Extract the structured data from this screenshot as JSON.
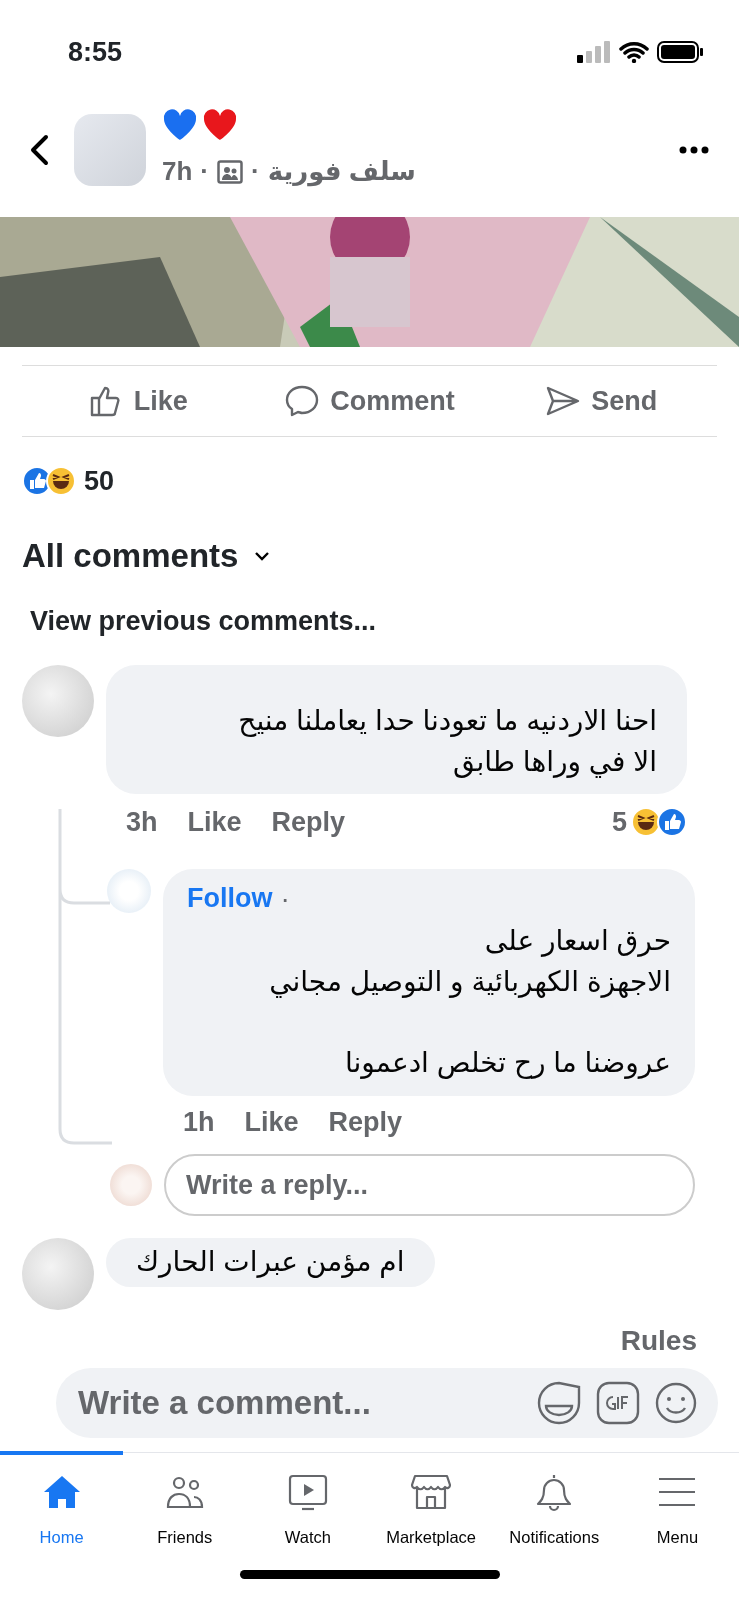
{
  "status_bar": {
    "time": "8:55"
  },
  "post_header": {
    "time": "7h",
    "separators": [
      "·",
      "·"
    ],
    "group": "سلف فورية"
  },
  "actions": [
    {
      "kind": "like",
      "label": "Like"
    },
    {
      "kind": "comment",
      "label": "Comment"
    },
    {
      "kind": "send",
      "label": "Send"
    }
  ],
  "reactions": {
    "count": "50"
  },
  "comments_header": {
    "label": "All comments",
    "view_previous": "View previous comments..."
  },
  "comments": [
    {
      "text": "احنا الاردنيه ما تعودنا حدا يعاملنا منيح\nالا في وراها طابق",
      "time": "3h",
      "like": "Like",
      "reply": "Reply",
      "reaction_count": "5",
      "reply_placeholder": "Write a reply...",
      "children": [
        {
          "follow": "Follow",
          "separator": "·",
          "text": "حرق اسعار على\nالاجهزة الكهربائية و التوصيل مجاني\n\nعروضنا ما رح تخلص ادعمونا",
          "time": "1h",
          "like": "Like",
          "reply": "Reply"
        }
      ]
    },
    {
      "text": "ام مؤمن عبرات الحارك"
    }
  ],
  "composer": {
    "rules": "Rules",
    "placeholder": "Write a comment..."
  },
  "tabs": [
    {
      "label": "Home",
      "kind": "home",
      "selected": true
    },
    {
      "label": "Friends",
      "kind": "friends",
      "selected": false
    },
    {
      "label": "Watch",
      "kind": "watch",
      "selected": false
    },
    {
      "label": "Marketplace",
      "kind": "marketplace",
      "selected": false
    },
    {
      "label": "Notifications",
      "kind": "notifications",
      "selected": false
    },
    {
      "label": "Menu",
      "kind": "menu",
      "selected": false
    }
  ]
}
